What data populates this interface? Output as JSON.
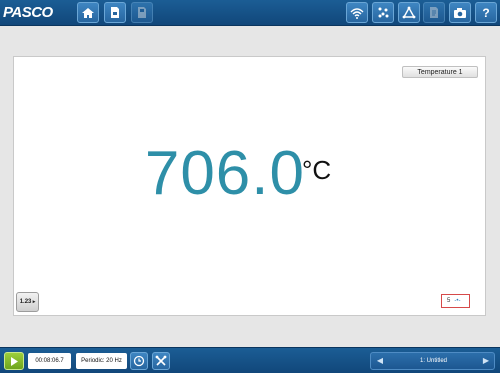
{
  "toolbar": {
    "brand": "PASCO",
    "left_icons": [
      "home-icon",
      "file-icon",
      "save-icon"
    ],
    "right_icons": [
      "wireless-icon",
      "sensor-points-icon",
      "calculator-icon",
      "journal-icon",
      "camera-icon",
      "help-icon"
    ],
    "help_label": "?"
  },
  "display": {
    "sensor": "Temperature 1",
    "value": "706.0",
    "unit": "°C",
    "digits_label": "1.23",
    "range_value": "5"
  },
  "controls": {
    "elapsed_time": "00:08:06.7",
    "sampling_mode": "Periodic: 20 Hz"
  },
  "page_nav": {
    "label": "1: Untitled"
  },
  "colors": {
    "toolbar": "#1b5d95",
    "value": "#2e8fa8",
    "play": "#8cc63f",
    "range_border": "#d64a4a"
  }
}
